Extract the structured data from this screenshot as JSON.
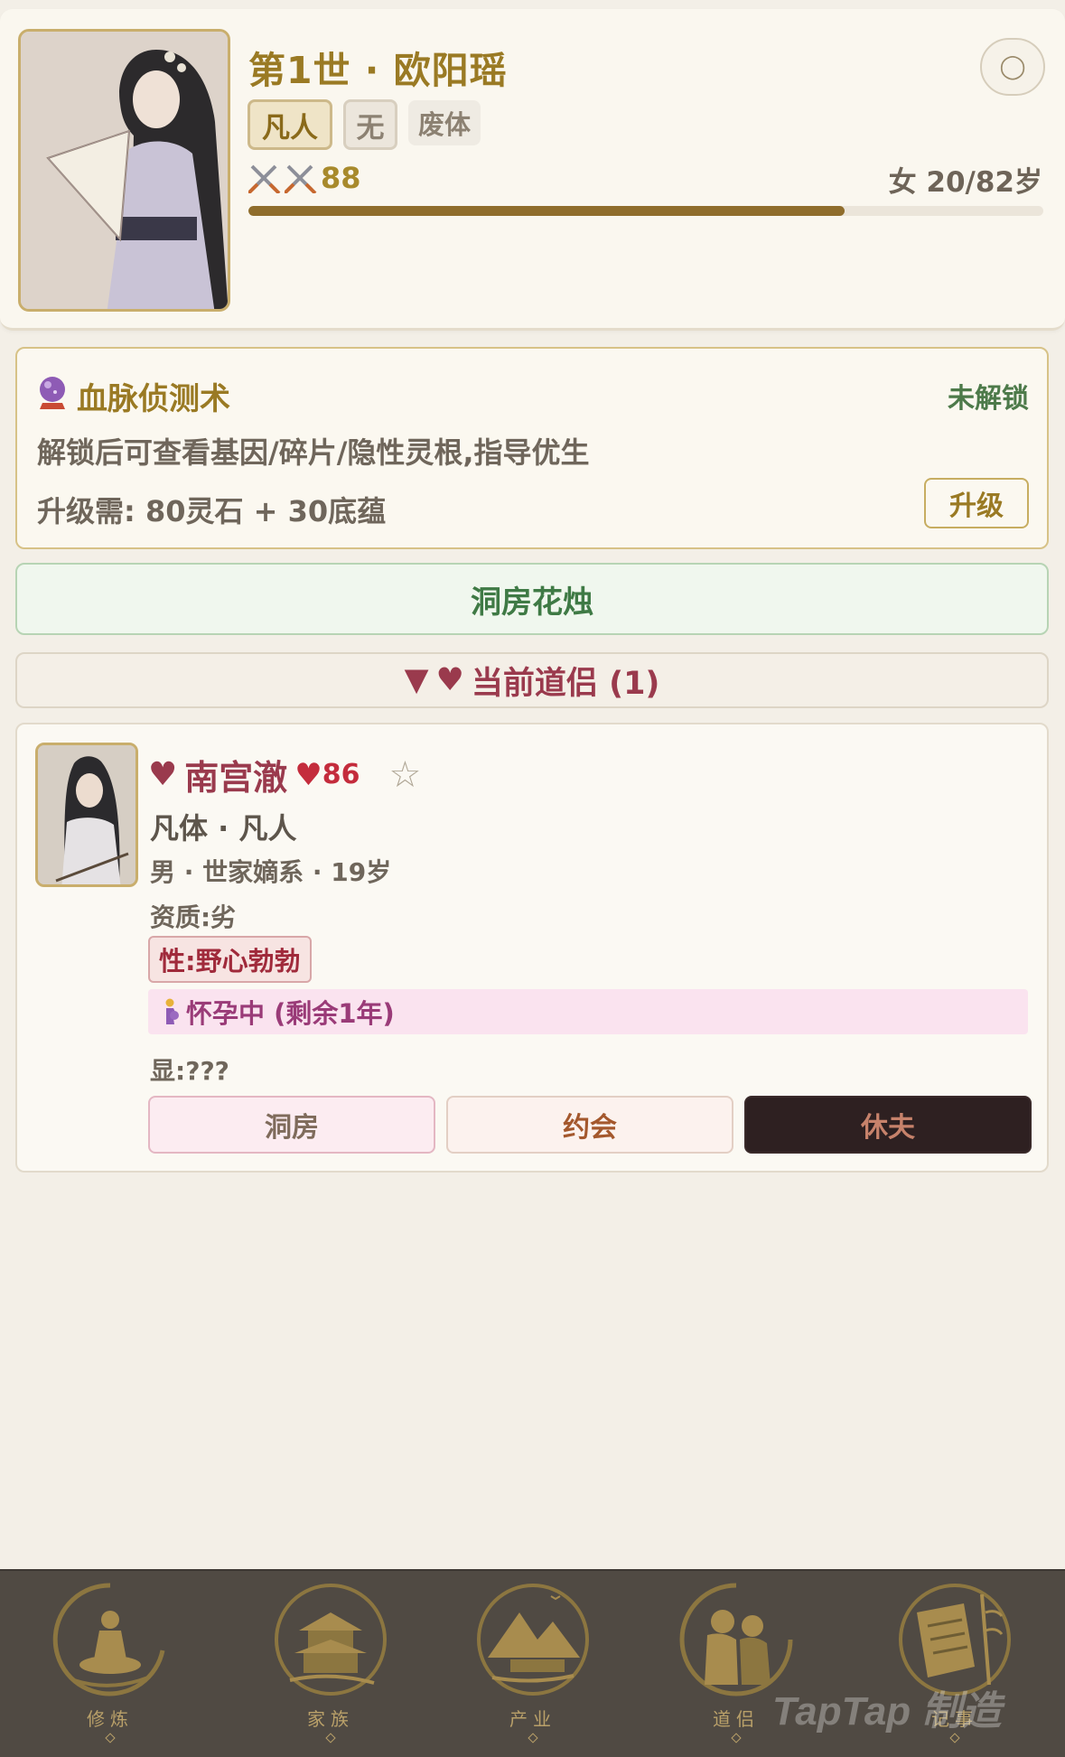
{
  "character": {
    "title": "第1世 · 欧阳瑶",
    "tags": [
      "凡人",
      "无",
      "废体"
    ],
    "power": "88",
    "age_text": "女 20/82岁",
    "lifespan_fraction": 0.75,
    "menu_icon": "more-icon"
  },
  "bloodline": {
    "title": "血脉侦测术",
    "status": "未解锁",
    "description": "解锁后可查看基因/碎片/隐性灵根,指导优生",
    "cost": "升级需: 80灵石 + 30底蕴",
    "upgrade_label": "升级",
    "icon": "crystal-ball-icon"
  },
  "bridal_button": "洞房花烛",
  "spouse_section": {
    "header_arrow": "▼",
    "header_heart": "♥",
    "header_label": "当前道侣 (1)"
  },
  "spouse": {
    "heart": "♥",
    "name": "南宫澈",
    "favor_heart": "♥",
    "favor": "86",
    "star": "☆",
    "body_realm": "凡体 · 凡人",
    "info": "男 · 世家嫡系 · 19岁",
    "aptitude": "资质:劣",
    "trait": "性:野心勃勃",
    "pregnancy": "怀孕中 (剩余1年)",
    "visible": "显:???",
    "actions": [
      "洞房",
      "约会",
      "休夫"
    ]
  },
  "nav": {
    "items": [
      {
        "label": "修炼",
        "icon": "meditation-icon"
      },
      {
        "label": "家族",
        "icon": "palace-icon"
      },
      {
        "label": "产业",
        "icon": "mountain-landscape-icon"
      },
      {
        "label": "道侣",
        "icon": "couple-icon"
      },
      {
        "label": "记事",
        "icon": "scroll-icon"
      }
    ]
  },
  "watermark": "TapTap 制造",
  "colors": {
    "gold": "#9a7a24",
    "rose": "#9a3a4d",
    "green": "#3f7a45",
    "nav_bg": "#504a43"
  }
}
